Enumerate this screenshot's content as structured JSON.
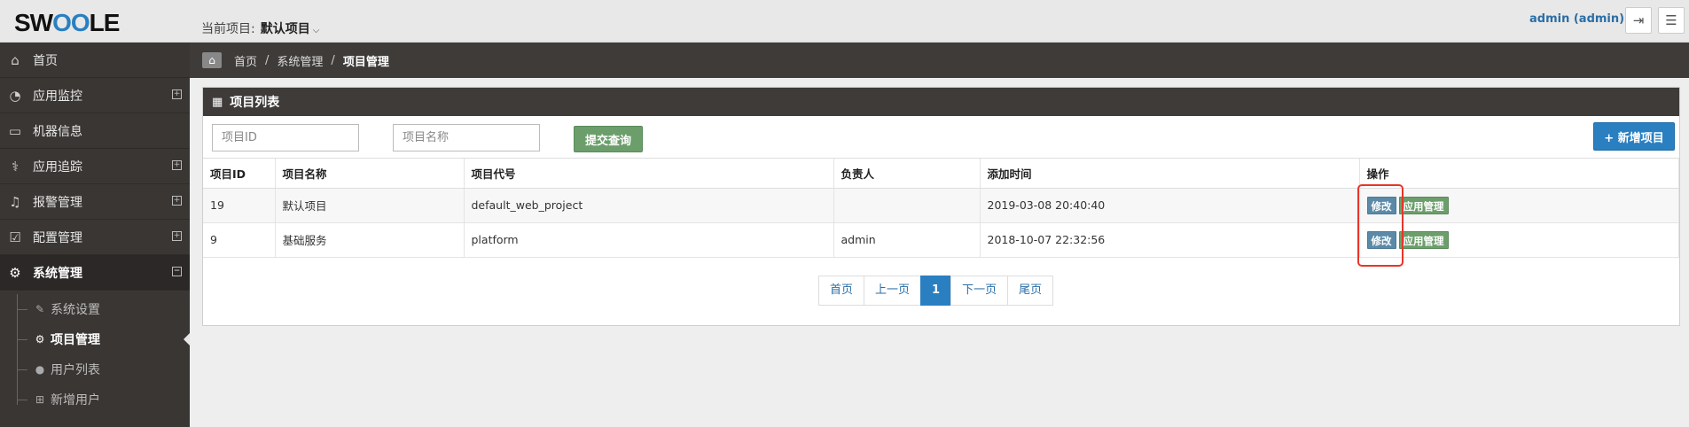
{
  "header": {
    "logo_pre": "SW",
    "logo_mid": "OO",
    "logo_post": "LE",
    "project_label": "当前项目:",
    "project_value": "默认项目",
    "user": "admin (admin)"
  },
  "sidebar": {
    "items": [
      {
        "label": "首页",
        "icon": "home-icon"
      },
      {
        "label": "应用监控",
        "icon": "dashboard-icon"
      },
      {
        "label": "机器信息",
        "icon": "monitor-icon"
      },
      {
        "label": "应用追踪",
        "icon": "stethoscope-icon"
      },
      {
        "label": "报警管理",
        "icon": "bell-icon"
      },
      {
        "label": "配置管理",
        "icon": "check-square-icon"
      },
      {
        "label": "系统管理",
        "icon": "gear-icon"
      }
    ],
    "submenu": [
      {
        "label": "系统设置",
        "icon": "wrench-icon"
      },
      {
        "label": "项目管理",
        "icon": "gears-icon"
      },
      {
        "label": "用户列表",
        "icon": "user-icon"
      },
      {
        "label": "新增用户",
        "icon": "plus-square-icon"
      }
    ]
  },
  "breadcrumb": {
    "home": "首页",
    "sep": "/",
    "level2": "系统管理",
    "current": "项目管理"
  },
  "panel": {
    "title": "项目列表",
    "search_id_placeholder": "项目ID",
    "search_name_placeholder": "项目名称",
    "query_label": "提交查询",
    "new_label": "+ 新增项目"
  },
  "table": {
    "headers": [
      "项目ID",
      "项目名称",
      "项目代号",
      "负责人",
      "添加时间",
      "操作"
    ],
    "rows": [
      {
        "id": "19",
        "name": "默认项目",
        "code": "default_web_project",
        "owner": "",
        "time": "2019-03-08 20:40:40"
      },
      {
        "id": "9",
        "name": "基础服务",
        "code": "platform",
        "owner": "admin",
        "time": "2018-10-07 22:32:56"
      }
    ],
    "edit_label": "修改",
    "app_label": "应用管理"
  },
  "pager": {
    "first": "首页",
    "prev": "上一页",
    "current": "1",
    "next": "下一页",
    "last": "尾页"
  },
  "colors": {
    "accent": "#2a7fc1",
    "sidebar_bg": "#3a3634",
    "success": "#6b9e6b",
    "highlight": "#e8352a"
  }
}
